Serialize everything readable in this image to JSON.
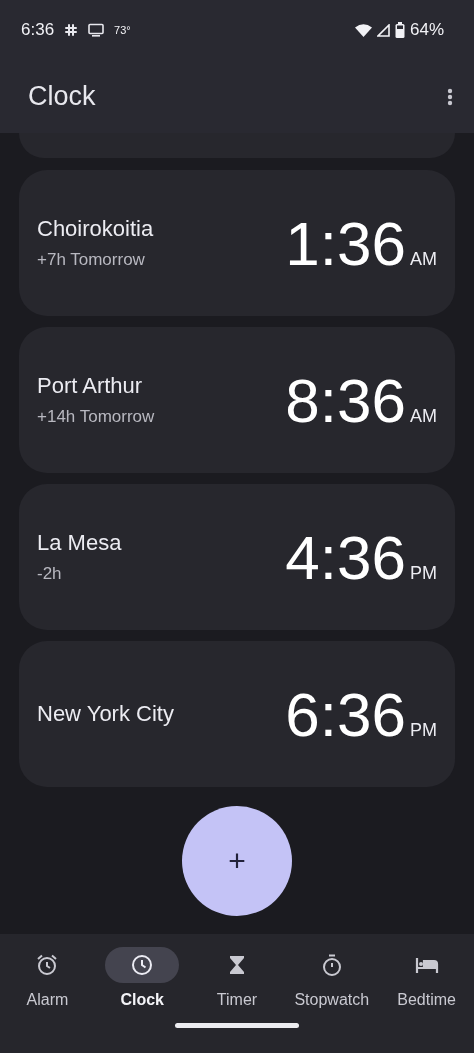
{
  "status_bar": {
    "time": "6:36",
    "temperature": "73°",
    "battery": "64%"
  },
  "app_bar": {
    "title": "Clock"
  },
  "clocks": [
    {
      "city": "Choirokoitia",
      "offset": "+7h Tomorrow",
      "time": "1:36",
      "period": "AM"
    },
    {
      "city": "Port Arthur",
      "offset": "+14h Tomorrow",
      "time": "8:36",
      "period": "AM"
    },
    {
      "city": "La Mesa",
      "offset": "-2h",
      "time": "4:36",
      "period": "PM"
    },
    {
      "city": "New York City",
      "time": "6:36",
      "period": "PM"
    }
  ],
  "fab": {
    "label": "+"
  },
  "nav": [
    {
      "kind": "alarm",
      "label": "Alarm",
      "selected": false
    },
    {
      "kind": "clock",
      "label": "Clock",
      "selected": true
    },
    {
      "kind": "timer",
      "label": "Timer",
      "selected": false
    },
    {
      "kind": "stopwatch",
      "label": "Stopwatch",
      "selected": false
    },
    {
      "kind": "bedtime",
      "label": "Bedtime",
      "selected": false
    }
  ]
}
